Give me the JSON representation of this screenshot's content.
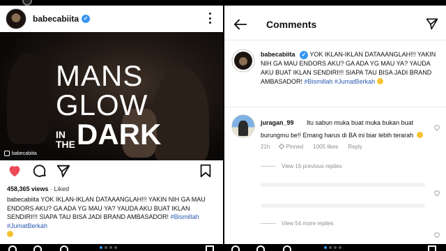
{
  "left": {
    "username": "babecabiita",
    "image": {
      "title_line1": "MANS",
      "title_line2": "GLOW",
      "title_in_top": "IN",
      "title_in_bottom": "THE",
      "title_dark": "DARK",
      "watermark": "babecabiita"
    },
    "views_count": "458,365 views",
    "views_suffix": " · Liked",
    "caption_user": "babecabiita",
    "caption_text": " YOK IKLAN-IKLAN DATAAANGLAH!!! YAKIN NIH GA MAU ENDORS AKU? GA ADA YG MAU YA? YAUDA AKU BUAT IKLAN SENDIRI!!! SIAPA TAU BISA JADI BRAND AMBASADOR! ",
    "hashtag1": "#Bismillah",
    "hashtag2": "#JumatBerkah"
  },
  "right": {
    "header_title": "Comments",
    "caption_user": "babecabiita",
    "caption_text": "YOK IKLAN-IKLAN DATAAANGLAH!!! YAKIN NIH GA MAU ENDORS AKU? GA ADA YG MAU YA? YAUDA AKU BUAT IKLAN SENDIRI!!! SIAPA TAU BISA JADI BRAND AMBASADOR! ",
    "hashtag1": "#Bismillah",
    "hashtag2": "#JumatBerkah",
    "comment": {
      "user": "juragan_99",
      "text": "Itu sabun muka buat muka bukan buat burungmu be!! Emang harus di BA ini biar lebih terarah",
      "time": "21h",
      "pinned": "Pinned",
      "likes": "1005 likes",
      "reply": "Reply"
    },
    "view_previous_replies": "View 16 previous replies",
    "view_more_replies": "View 54 more replies"
  },
  "colors": {
    "heart": "#ed4956",
    "verified": "#3897f0",
    "hashtag": "#2a5bb0",
    "muted": "#8e8e8e"
  }
}
